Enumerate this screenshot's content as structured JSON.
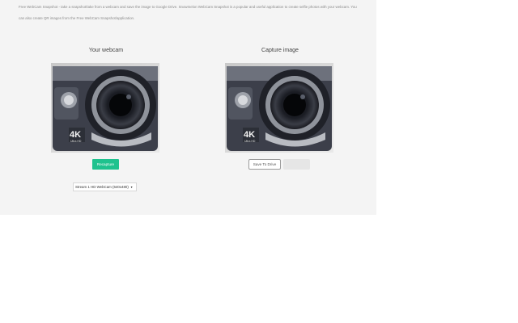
{
  "intro": {
    "line1": "Free WebCam Snapshot - take a snapshot/take from a webcam and save the image to Google Drive. Snowmelon WebCam Snapshot is a popular and useful application to create selfie photos with your webcam. You",
    "line2": "can also create QR images from the Free WebCam Snapshot/application."
  },
  "webcam_panel": {
    "title": "Your webcam",
    "recapture_label": "Recapture"
  },
  "capture_panel": {
    "title": "Capture image",
    "save_label": "Save To Drive"
  },
  "camera_select": {
    "selected": "Stream 1 HD WebCam (640x480)"
  },
  "image": {
    "badge_text": "4K",
    "badge_subtext": "Ultra HD"
  },
  "colors": {
    "recapture_button": "#1fc28e",
    "page_panel": "#f4f4f4"
  }
}
